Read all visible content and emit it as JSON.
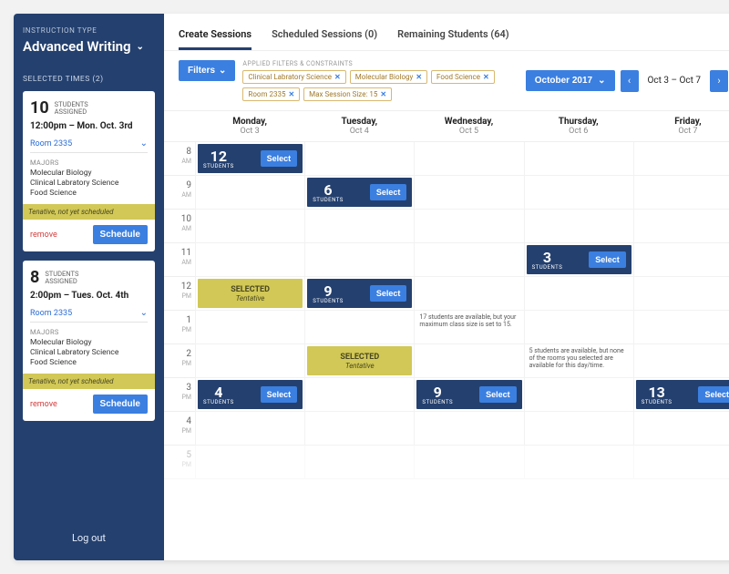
{
  "sidebar": {
    "instruction_type_label": "INSTRUCTION TYPE",
    "instruction_type_value": "Advanced Writing",
    "selected_times_label": "SELECTED TIMES (2)",
    "logout": "Log out",
    "cards": [
      {
        "count": "10",
        "assigned_label": "STUDENTS\nASSIGNED",
        "time": "12:00pm – Mon. Oct. 3rd",
        "room": "Room 2335",
        "majors_label": "MAJORS",
        "majors": [
          "Molecular Biology",
          "Clinical Labratory Science",
          "Food Science"
        ],
        "tentative": "Tenative, not yet scheduled",
        "remove": "remove",
        "schedule": "Schedule"
      },
      {
        "count": "8",
        "assigned_label": "STUDENTS\nASSIGNED",
        "time": "2:00pm – Tues. Oct. 4th",
        "room": "Room 2335",
        "majors_label": "MAJORS",
        "majors": [
          "Molecular Biology",
          "Clinical Labratory Science",
          "Food Science"
        ],
        "tentative": "Tenative, not yet scheduled",
        "remove": "remove",
        "schedule": "Schedule"
      }
    ]
  },
  "tabs": {
    "t0": "Create Sessions",
    "t1": "Scheduled Sessions (0)",
    "t2": "Remaining Students (64)"
  },
  "filters": {
    "button": "Filters",
    "applied_label": "APPLIED FILTERS & CONSTRAINTS",
    "chips": [
      "Clinical Labratory Science",
      "Molecular Biology",
      "Food Science",
      "Room 2335",
      "Max Session Size: 15"
    ]
  },
  "date": {
    "month": "October 2017",
    "range": "Oct 3 – Oct 7"
  },
  "days": [
    {
      "dow": "Monday,",
      "date": "Oct 3"
    },
    {
      "dow": "Tuesday,",
      "date": "Oct 4"
    },
    {
      "dow": "Wednesday,",
      "date": "Oct 5"
    },
    {
      "dow": "Thursday,",
      "date": "Oct 6"
    },
    {
      "dow": "Friday,",
      "date": "Oct 7"
    }
  ],
  "hours": [
    {
      "h": "8",
      "ap": "AM"
    },
    {
      "h": "9",
      "ap": "AM"
    },
    {
      "h": "10",
      "ap": "AM"
    },
    {
      "h": "11",
      "ap": "AM"
    },
    {
      "h": "12",
      "ap": "PM"
    },
    {
      "h": "1",
      "ap": "PM"
    },
    {
      "h": "2",
      "ap": "PM"
    },
    {
      "h": "3",
      "ap": "PM"
    },
    {
      "h": "4",
      "ap": "PM"
    },
    {
      "h": "5",
      "ap": "PM"
    }
  ],
  "blocks": {
    "students_label": "STUDENTS",
    "select_label": "Select",
    "selected_label": "SELECTED",
    "tentative_label": "Tentative",
    "b_8_mon": "12",
    "b_9_tue": "6",
    "b_11_thu": "3",
    "b_12_tue": "9",
    "b_3_mon": "4",
    "b_3_wed": "9",
    "b_3_fri": "13",
    "note_1_wed": "17 students are available, but your maximum class size is set to 15.",
    "note_2_thu": "5 students are available, but none of the rooms you selected are available for this day/time."
  }
}
